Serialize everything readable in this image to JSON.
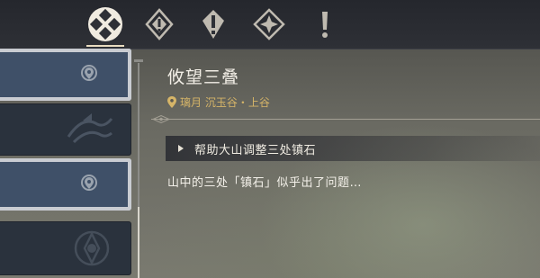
{
  "tabs": [
    {
      "icon": "archon-quest-icon",
      "selected": true
    },
    {
      "icon": "story-quest-icon",
      "selected": false
    },
    {
      "icon": "world-quest-icon",
      "selected": false
    },
    {
      "icon": "commission-icon",
      "selected": false
    },
    {
      "icon": "event-quest-icon",
      "selected": false
    }
  ],
  "quest_list": [
    {
      "style": "light",
      "icon": "location-pin-icon"
    },
    {
      "style": "dark",
      "icon": "liyue-emblem-icon"
    },
    {
      "style": "light",
      "icon": "location-pin-icon"
    },
    {
      "style": "dark",
      "icon": "mondstadt-emblem-icon"
    }
  ],
  "quest": {
    "title": "攸望三叠",
    "location": "璃月 沉玉谷・上谷",
    "objective": "帮助大山调整三处镇石",
    "description": "山中的三处「镇石」似乎出了问题…"
  },
  "colors": {
    "location_text": "#d6b568",
    "selected_tab_underline": "#e9dcc0"
  }
}
